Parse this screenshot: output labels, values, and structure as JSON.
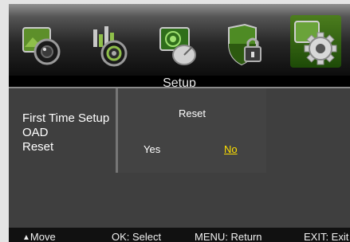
{
  "menu": {
    "title": "Setup",
    "icons": [
      "picture-icon",
      "sound-icon",
      "channel-icon",
      "lock-icon",
      "setup-gear-icon"
    ],
    "selected_index": 4
  },
  "setup_items": [
    {
      "label": "First Time Setup"
    },
    {
      "label": "OAD"
    },
    {
      "label": "Reset"
    }
  ],
  "dialog": {
    "title": "Reset",
    "yes_label": "Yes",
    "no_label": "No",
    "selected": "No"
  },
  "footer": {
    "move_icon": "up-down-arrows-icon",
    "move_label": "Move",
    "ok_label": "OK: Select",
    "menu_label": "MENU: Return",
    "exit_label": "EXIT: Exit"
  },
  "colors": {
    "selected_option": "#ffe000",
    "selected_tab": "#3a6b14"
  }
}
